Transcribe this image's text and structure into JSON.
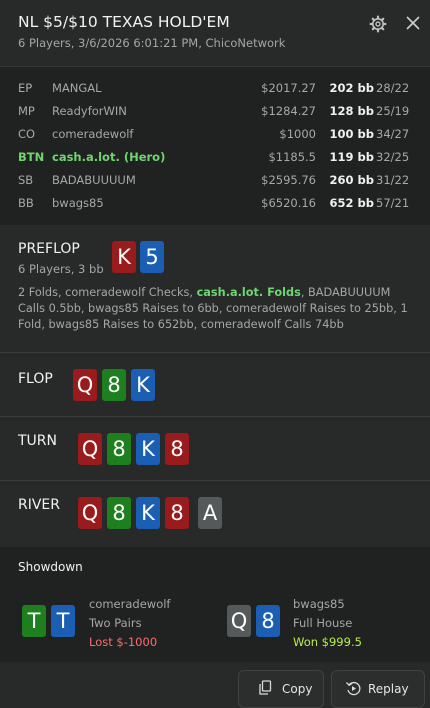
{
  "header": {
    "title": "NL $5/$10 TEXAS HOLD'EM",
    "subtitle": "6 Players, 3/6/2026 6:01:21 PM, ChicoNetwork"
  },
  "players": [
    {
      "pos": "EP",
      "name": "MANGAL",
      "stack": "$2017.27",
      "bb": "202 bb",
      "ratio": "28/22",
      "hero": false
    },
    {
      "pos": "MP",
      "name": "ReadyforWIN",
      "stack": "$1284.27",
      "bb": "128 bb",
      "ratio": "25/19",
      "hero": false
    },
    {
      "pos": "CO",
      "name": "comeradewolf",
      "stack": "$1000",
      "bb": "100 bb",
      "ratio": "34/27",
      "hero": false
    },
    {
      "pos": "BTN",
      "name": "cash.a.lot. (Hero)",
      "stack": "$1185.5",
      "bb": "119 bb",
      "ratio": "32/25",
      "hero": true
    },
    {
      "pos": "SB",
      "name": "BADABUUUUM",
      "stack": "$2595.76",
      "bb": "260 bb",
      "ratio": "31/22",
      "hero": false
    },
    {
      "pos": "BB",
      "name": "bwags85",
      "stack": "$6520.16",
      "bb": "652 bb",
      "ratio": "57/21",
      "hero": false
    }
  ],
  "preflop": {
    "title": "PREFLOP",
    "subtitle": "6 Players, 3 bb",
    "hero_cards": [
      {
        "rank": "K",
        "color": "red"
      },
      {
        "rank": "5",
        "color": "blue"
      }
    ],
    "actions_before": "2 Folds, comeradewolf Checks, ",
    "actions_hero": "cash.a.lot. Folds",
    "actions_after": ", BADABUUUUM Calls 0.5bb, bwags85 Raises to 6bb, comeradewolf Raises to 25bb, 1 Fold, bwags85 Raises to 652bb, comeradewolf Calls 74bb"
  },
  "flop": {
    "title": "FLOP",
    "cards": [
      {
        "rank": "Q",
        "color": "red"
      },
      {
        "rank": "8",
        "color": "green"
      },
      {
        "rank": "K",
        "color": "blue"
      }
    ]
  },
  "turn": {
    "title": "TURN",
    "cards": [
      {
        "rank": "Q",
        "color": "red"
      },
      {
        "rank": "8",
        "color": "green"
      },
      {
        "rank": "K",
        "color": "blue"
      },
      {
        "rank": "8",
        "color": "red"
      }
    ]
  },
  "river": {
    "title": "RIVER",
    "cards": [
      {
        "rank": "Q",
        "color": "red"
      },
      {
        "rank": "8",
        "color": "green"
      },
      {
        "rank": "K",
        "color": "blue"
      },
      {
        "rank": "8",
        "color": "red"
      },
      {
        "rank": "A",
        "color": "gray"
      }
    ]
  },
  "showdown": {
    "title": "Showdown",
    "players": [
      {
        "name": "comeradewolf",
        "hand": "Two Pairs",
        "result": "Lost $-1000",
        "result_color": "#ff6b6b",
        "cards": [
          {
            "rank": "T",
            "color": "green"
          },
          {
            "rank": "T",
            "color": "blue"
          }
        ]
      },
      {
        "name": "bwags85",
        "hand": "Full House",
        "result": "Won $999.5",
        "result_color": "#b6f04a",
        "cards": [
          {
            "rank": "Q",
            "color": "gray"
          },
          {
            "rank": "8",
            "color": "blue"
          }
        ]
      }
    ]
  },
  "footer": {
    "copy_label": "Copy",
    "replay_label": "Replay"
  },
  "icons": {
    "settings": "gear-icon",
    "close": "close-icon",
    "copy": "copy-icon",
    "replay": "replay-icon"
  }
}
